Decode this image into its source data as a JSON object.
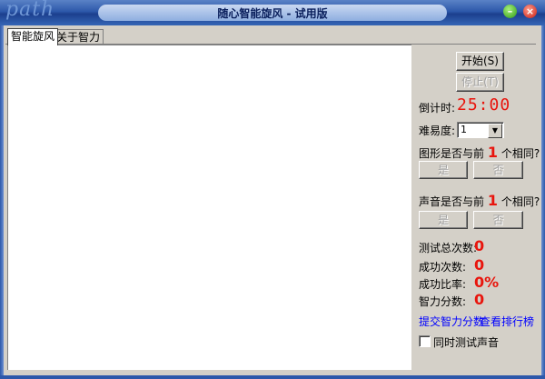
{
  "window": {
    "title": "随心智能旋风 - 试用版",
    "logo_text": "path"
  },
  "tabs": [
    {
      "label": "智能旋风"
    },
    {
      "label": "关于智力"
    }
  ],
  "panel": {
    "start_label": "开始(S)",
    "stop_label": "停止(T)",
    "countdown_label": "倒计时:",
    "countdown_value": "25:00",
    "difficulty_label": "难易度:",
    "difficulty_value": "1",
    "shape_prefix": "图形是否与前",
    "shape_count": "1",
    "shape_suffix": "个相同?",
    "shape_yes": "是",
    "shape_no": "否",
    "sound_prefix": "声音是否与前",
    "sound_count": "1",
    "sound_suffix": "个相同?",
    "sound_yes": "是",
    "sound_no": "否",
    "stats": [
      {
        "label": "测试总次数:",
        "value": "0"
      },
      {
        "label": "成功次数:",
        "value": "0"
      },
      {
        "label": "成功比率:",
        "value": "0%"
      },
      {
        "label": "智力分数:",
        "value": "0"
      }
    ],
    "submit_link": "提交智力分数",
    "ranking_link": "查看排行榜",
    "sound_test_label": "同时测试声音"
  },
  "colors": {
    "accent_red": "#e8150d",
    "link_blue": "#0000ff",
    "titlebar_blue": "#2d58aa"
  }
}
